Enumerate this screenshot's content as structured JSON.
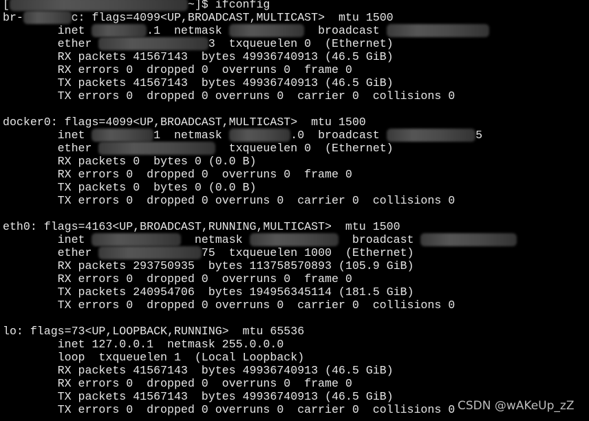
{
  "terminal": {
    "lines": [
      [
        {
          "t": "["
        },
        {
          "r": "                          "
        },
        {
          "t": "~]$ ifconfig"
        }
      ],
      [
        {
          "t": "br-"
        },
        {
          "r": "       "
        },
        {
          "t": "c: flags=4099<UP,BROADCAST,MULTICAST>  mtu 1500"
        }
      ],
      [
        {
          "t": "        inet "
        },
        {
          "r": "        "
        },
        {
          "t": ".1  netmask "
        },
        {
          "r": "           "
        },
        {
          "t": "  broadcast "
        },
        {
          "r": "               "
        }
      ],
      [
        {
          "t": "        ether "
        },
        {
          "r": "                "
        },
        {
          "t": "3  txqueuelen 0  (Ethernet)"
        }
      ],
      [
        {
          "t": "        RX packets 41567143  bytes 49936740913 (46.5 GiB)"
        }
      ],
      [
        {
          "t": "        RX errors 0  dropped 0  overruns 0  frame 0"
        }
      ],
      [
        {
          "t": "        TX packets 41567143  bytes 49936740913 (46.5 GiB)"
        }
      ],
      [
        {
          "t": "        TX errors 0  dropped 0 overruns 0  carrier 0  collisions 0"
        }
      ],
      [
        {
          "t": ""
        }
      ],
      [
        {
          "t": "docker0: flags=4099<UP,BROADCAST,MULTICAST>  mtu 1500"
        }
      ],
      [
        {
          "t": "        inet "
        },
        {
          "r": "         "
        },
        {
          "t": "1  netmask "
        },
        {
          "r": "         "
        },
        {
          "t": ".0  broadcast "
        },
        {
          "r": "             "
        },
        {
          "t": "5"
        }
      ],
      [
        {
          "t": "        ether "
        },
        {
          "r": "                 "
        },
        {
          "t": "  txqueuelen 0  (Ethernet)"
        }
      ],
      [
        {
          "t": "        RX packets 0  bytes 0 (0.0 B)"
        }
      ],
      [
        {
          "t": "        RX errors 0  dropped 0  overruns 0  frame 0"
        }
      ],
      [
        {
          "t": "        TX packets 0  bytes 0 (0.0 B)"
        }
      ],
      [
        {
          "t": "        TX errors 0  dropped 0 overruns 0  carrier 0  collisions 0"
        }
      ],
      [
        {
          "t": ""
        }
      ],
      [
        {
          "t": "eth0: flags=4163<UP,BROADCAST,RUNNING,MULTICAST>  mtu 1500"
        }
      ],
      [
        {
          "t": "        inet "
        },
        {
          "r": "             "
        },
        {
          "t": "  netmask "
        },
        {
          "r": "             "
        },
        {
          "t": "  broadcast "
        },
        {
          "r": "              "
        }
      ],
      [
        {
          "t": "        ether "
        },
        {
          "r": "               "
        },
        {
          "t": "75  txqueuelen 1000  (Ethernet)"
        }
      ],
      [
        {
          "t": "        RX packets 293750935  bytes 113758570893 (105.9 GiB)"
        }
      ],
      [
        {
          "t": "        RX errors 0  dropped 0  overruns 0  frame 0"
        }
      ],
      [
        {
          "t": "        TX packets 240954706  bytes 194956345114 (181.5 GiB)"
        }
      ],
      [
        {
          "t": "        TX errors 0  dropped 0 overruns 0  carrier 0  collisions 0"
        }
      ],
      [
        {
          "t": ""
        }
      ],
      [
        {
          "t": "lo: flags=73<UP,LOOPBACK,RUNNING>  mtu 65536"
        }
      ],
      [
        {
          "t": "        inet 127.0.0.1  netmask 255.0.0.0"
        }
      ],
      [
        {
          "t": "        loop  txqueuelen 1  (Local Loopback)"
        }
      ],
      [
        {
          "t": "        RX packets 41567143  bytes 49936740913 (46.5 GiB)"
        }
      ],
      [
        {
          "t": "        RX errors 0  dropped 0  overruns 0  frame 0"
        }
      ],
      [
        {
          "t": "        TX packets 41567143  bytes 49936740913 (46.5 GiB)"
        }
      ],
      [
        {
          "t": "        TX errors 0  dropped 0 overruns 0  carrier 0  collisions 0"
        }
      ]
    ]
  },
  "watermark": "CSDN @wAKeUp_zZ",
  "colors": {
    "background": "#000000",
    "text": "#e6e6e6",
    "watermark": "#bdbdbd"
  }
}
